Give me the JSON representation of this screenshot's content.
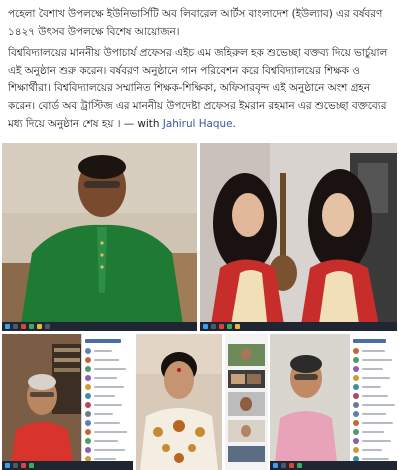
{
  "post": {
    "line1": "পহেলা বৈশাখ উপলক্ষে ইউনিভার্সিটি অব লিবারেল আর্টস বাংলাদেশ (ইউল্যাব) এর বর্ষবরণ ১৪২৭ উৎসব উপলক্ষে বিশেষ আয়োজন।",
    "para2": "বিশ্ববিদ্যালয়ের মাননীয় উপাচার্য প্রফেসর এইচ এম জহিরুল হক শুভেচ্ছা বক্তব্য দিয়ে ভার্চুয়াল এই অনুষ্ঠান শুরু করেন। বর্ষবরণ অনুষ্ঠানে গান পরিবেশন করে বিশ্ববিদ্যালয়ের শিক্ষক ও শিক্ষার্থীরা। বিশ্ববিদ্যালয়ের সম্মানিত শিক্ষক-শিক্ষিকা, অফিসারবৃন্দ এই অনুষ্ঠানে অংশ গ্রহন করেন। বোর্ড অব ট্রাস্টিজ এর মাননীয় উপদেষ্টা প্রফেসর ইমরান রহমান এর শুভেচ্ছা বক্তব্যের মধ্য দিয়ে অনুষ্ঠান শেষ হয় ।",
    "separator": " — with ",
    "tagged_name": "Jahirul Haque",
    "tagged_suffix": "."
  },
  "photos": [
    {
      "name": "man-green-panjabi",
      "panel": false
    },
    {
      "name": "two-women-singing",
      "panel": false
    },
    {
      "name": "older-man-red-shirt",
      "panel": true
    },
    {
      "name": "dancer-with-bindi",
      "panel": false
    },
    {
      "name": "gallery-view-call",
      "panel": true
    },
    {
      "name": "man-glasses-video",
      "panel": true
    }
  ],
  "colors": {
    "link": "#385898",
    "text": "#1d2129",
    "panjabi_green": "#1f7a33",
    "saree_red": "#c72d2a",
    "saree_cream": "#f1dfb8"
  }
}
